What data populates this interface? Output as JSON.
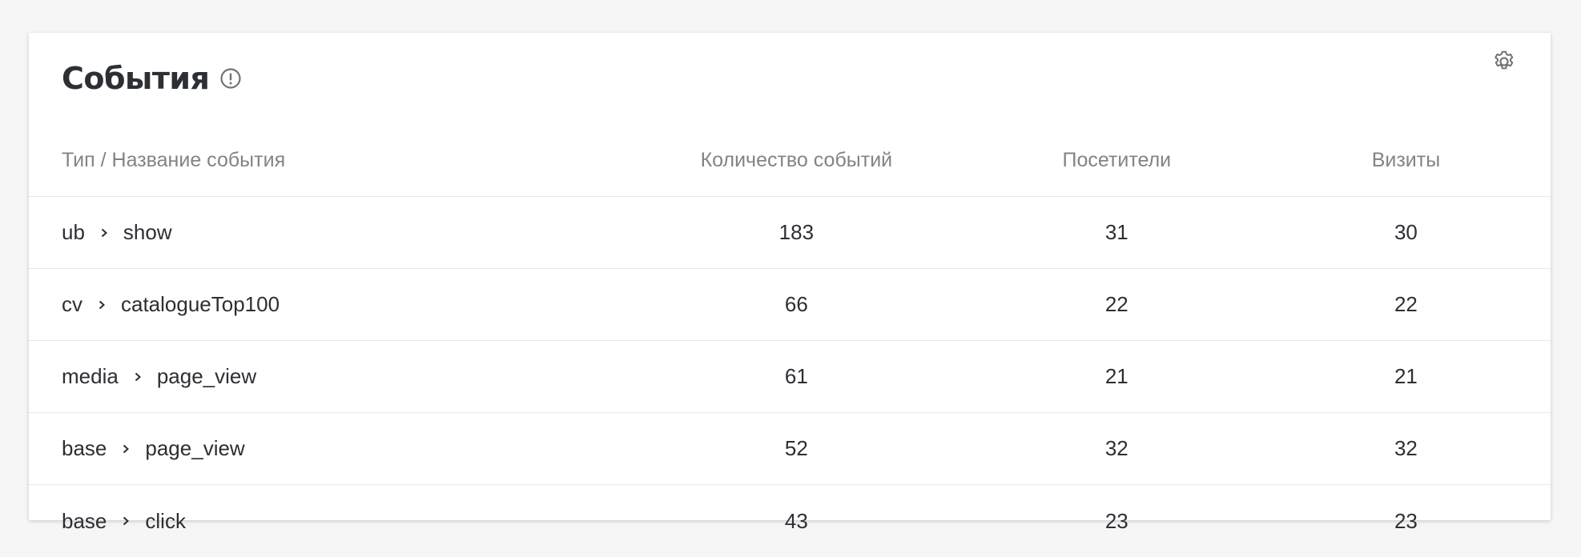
{
  "widget": {
    "title": "События",
    "info_icon": "exclamation-circle-icon",
    "settings_icon": "gear-icon"
  },
  "table": {
    "columns": [
      "Тип / Название события",
      "Количество событий",
      "Посетители",
      "Визиты"
    ],
    "rows": [
      {
        "type": "ub",
        "name": "show",
        "events": "183",
        "visitors": "31",
        "visits": "30"
      },
      {
        "type": "cv",
        "name": "catalogueTop100",
        "events": "66",
        "visitors": "22",
        "visits": "22"
      },
      {
        "type": "media",
        "name": "page_view",
        "events": "61",
        "visitors": "21",
        "visits": "21"
      },
      {
        "type": "base",
        "name": "page_view",
        "events": "52",
        "visitors": "32",
        "visits": "32"
      },
      {
        "type": "base",
        "name": "click",
        "events": "43",
        "visitors": "23",
        "visits": "23"
      }
    ]
  },
  "colors": {
    "text": "#2c2f33",
    "muted": "#808489",
    "divider": "#e7e8ea"
  }
}
